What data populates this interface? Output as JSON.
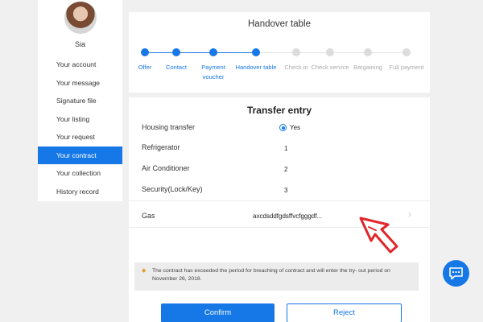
{
  "sidebar": {
    "username": "Sia",
    "items": [
      {
        "label": "Your account"
      },
      {
        "label": "Your message"
      },
      {
        "label": "Signature file"
      },
      {
        "label": "Your listing"
      },
      {
        "label": "Your request"
      },
      {
        "label": "Your contract"
      },
      {
        "label": "Your collection"
      },
      {
        "label": "History record"
      }
    ],
    "active_item": "Your contract"
  },
  "progress": {
    "title": "Handover table",
    "steps": [
      {
        "label": "Offer",
        "status": "done"
      },
      {
        "label": "Contact",
        "status": "done"
      },
      {
        "label": "Payment voucher",
        "status": "done"
      },
      {
        "label": "Handover table",
        "status": "done"
      },
      {
        "label": "Check in",
        "status": "pending"
      },
      {
        "label": "Check service",
        "status": "pending"
      },
      {
        "label": "Bargaining",
        "status": "pending"
      },
      {
        "label": "Full payment",
        "status": "pending"
      }
    ]
  },
  "transfer": {
    "title": "Transfer entry",
    "rows": [
      {
        "label": "Housing transfer",
        "value": "Yes"
      },
      {
        "label": "Refrigerator",
        "value": "1"
      },
      {
        "label": "Air Conditioner",
        "value": "2"
      },
      {
        "label": "Security(Lock/Key)",
        "value": "3"
      },
      {
        "label": "Gas",
        "value": "axcdsddfgdsffvcfgggdf..."
      }
    ]
  },
  "notice": {
    "text": "The contract has exceeded the period for breaching of contract and will enter the try- out period on November 26, 2018."
  },
  "actions": {
    "confirm_label": "Confirm",
    "reject_label": "Reject"
  },
  "colors": {
    "accent": "#1677e6",
    "annotation": "#e0262b",
    "notice_icon": "#e29a2d"
  },
  "icons": {
    "chevron": "chevron-right-icon",
    "chat": "chat-bubble-icon",
    "notice": "warning-icon"
  }
}
